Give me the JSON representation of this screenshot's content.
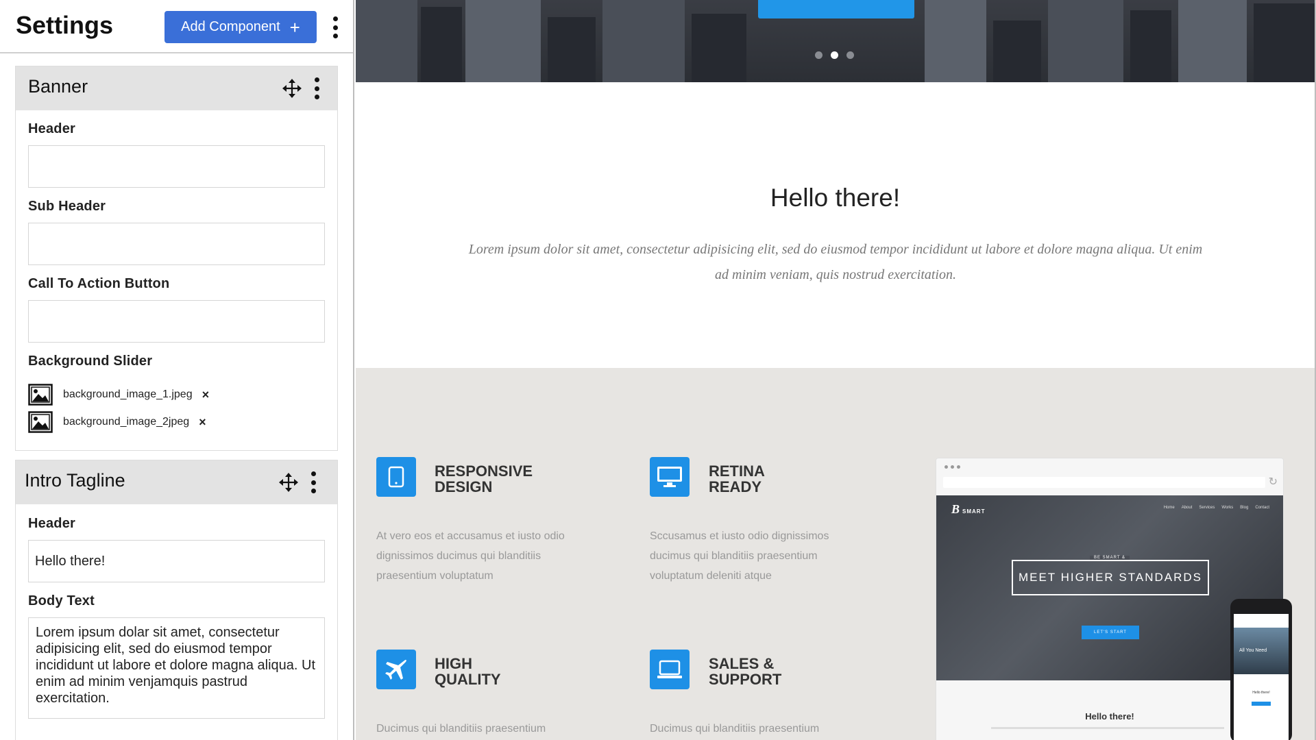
{
  "sidebar": {
    "title": "Settings",
    "add_button_label": "Add Component",
    "add_button_glyph": "+",
    "banner": {
      "title": "Banner",
      "header_label": "Header",
      "header_value": "",
      "subheader_label": "Sub Header",
      "subheader_value": "",
      "cta_label": "Call To Action Button",
      "cta_value": "",
      "slider_label": "Background Slider",
      "files": [
        {
          "name": "background_image_1.jpeg",
          "remove": "×"
        },
        {
          "name": "background_image_2jpeg",
          "remove": "×"
        }
      ]
    },
    "intro": {
      "title": "Intro Tagline",
      "header_label": "Header",
      "header_value": "Hello there!",
      "body_label": "Body Text",
      "body_value": "Lorem ipsum dolar sit amet, consectetur adipisicing elit, sed do eiusmod tempor incididunt ut labore et dolore magna aliqua. Ut enim ad minim venjamquis pastrud exercitation."
    }
  },
  "preview": {
    "hero_slide_index": 2,
    "hero_slide_count": 3,
    "intro_title": "Hello there!",
    "intro_body": "Lorem ipsum dolor sit amet, consectetur adipisicing elit, sed do eiusmod tempor incididunt ut labore et dolore magna aliqua. Ut enim ad minim veniam, quis nostrud exercitation.",
    "features": [
      {
        "icon": "tablet-icon",
        "title_line1": "RESPONSIVE",
        "title_line2": "DESIGN",
        "text": "At vero eos et accusamus et iusto odio dignissimos ducimus qui blanditiis praesentium voluptatum"
      },
      {
        "icon": "monitor-icon",
        "title_line1": "RETINA",
        "title_line2": "READY",
        "text": "Sccusamus et iusto odio dignissimos ducimus qui blanditiis praesentium voluptatum deleniti atque"
      },
      {
        "icon": "airplane-icon",
        "title_line1": "HIGH",
        "title_line2": "QUALITY",
        "text": "Ducimus qui blanditiis praesentium"
      },
      {
        "icon": "laptop-icon",
        "title_line1": "SALES &",
        "title_line2": "SUPPORT",
        "text": "Ducimus qui blanditiis praesentium"
      }
    ],
    "mockup": {
      "logo": "B",
      "logo_sub": "SMART",
      "nav": [
        "Home",
        "About",
        "Services",
        "Works",
        "Blog",
        "Contact"
      ],
      "kicker": "BE SMART &",
      "headline": "MEET HIGHER STANDARDS",
      "cta": "LET'S START",
      "hello": "Hello there!",
      "phone_caption": "All You Need",
      "phone_hello": "Hello there!"
    }
  },
  "colors": {
    "accent": "#3a6fd8",
    "feature_blue": "#1e90e6",
    "card_header": "#e3e3e3",
    "features_bg": "#e7e5e2"
  }
}
